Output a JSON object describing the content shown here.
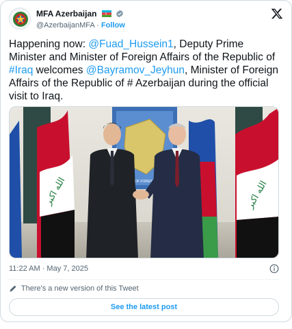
{
  "account": {
    "display_name": "MFA Azerbaijan",
    "handle": "@AzerbaijanMFA",
    "separator": "·",
    "follow_label": "Follow",
    "flag_icon": "azerbaijan-flag-icon",
    "verified_icon": "verified-badge-icon",
    "verified_color": "#829aab"
  },
  "tweet": {
    "t1": "Happening now: ",
    "mention1": "@Fuad_Hussein1",
    "t2": ", Deputy Prime Minister and Minister of Foreign Affairs of the Republic of ",
    "hashtag": "#Iraq",
    "t3": " welcomes ",
    "mention2": "@Bayramov_Jeyhun",
    "t4": ", Minister of Foreign Affairs of the Republic of # Azerbaijan during the official visit to Iraq."
  },
  "photo": {
    "banner_text": "MINISTRY OF FOREIGN AFFAIRS"
  },
  "meta": {
    "timestamp": "11:22 AM · May 7, 2025",
    "info_icon": "info-icon"
  },
  "edit_notice": {
    "icon": "pencil-icon",
    "text": "There's a new version of this Tweet",
    "button_label": "See the latest post"
  },
  "colors": {
    "accent": "#1d9bf0",
    "muted_text": "#536471",
    "border": "#cfd9de"
  }
}
